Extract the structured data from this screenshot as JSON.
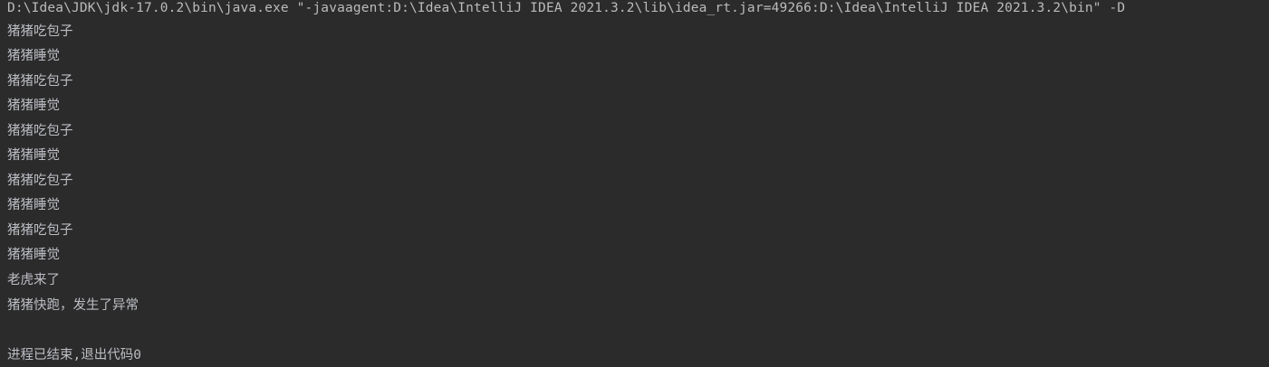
{
  "console": {
    "command_line": "D:\\Idea\\JDK\\jdk-17.0.2\\bin\\java.exe \"-javaagent:D:\\Idea\\IntelliJ IDEA 2021.3.2\\lib\\idea_rt.jar=49266:D:\\Idea\\IntelliJ IDEA 2021.3.2\\bin\" -D",
    "output_lines": [
      "猪猪吃包子",
      "猪猪睡觉",
      "猪猪吃包子",
      "猪猪睡觉",
      "猪猪吃包子",
      "猪猪睡觉",
      "猪猪吃包子",
      "猪猪睡觉",
      "猪猪吃包子",
      "猪猪睡觉",
      "老虎来了",
      "猪猪快跑，发生了异常"
    ],
    "exit_message": "进程已结束,退出代码0"
  },
  "colors": {
    "background": "#2b2b2b",
    "text": "#bbbbbb"
  }
}
